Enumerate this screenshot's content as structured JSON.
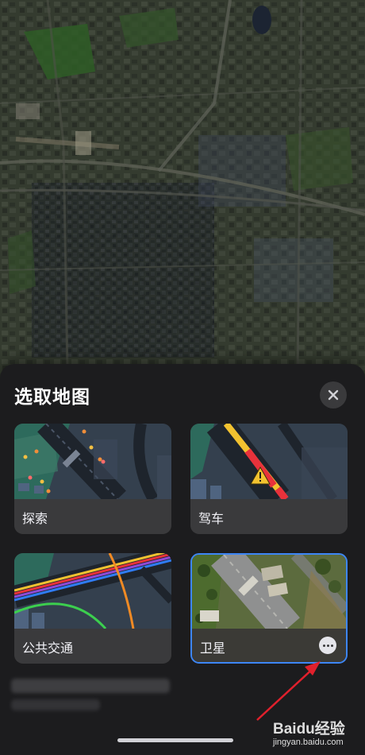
{
  "sheet": {
    "title": "选取地图",
    "close_icon": "close-icon"
  },
  "map_options": [
    {
      "id": "explore",
      "label": "探索",
      "selected": false
    },
    {
      "id": "driving",
      "label": "驾车",
      "selected": false
    },
    {
      "id": "transit",
      "label": "公共交通",
      "selected": false
    },
    {
      "id": "satellite",
      "label": "卫星",
      "selected": true,
      "more_icon": "ellipsis-icon"
    }
  ],
  "colors": {
    "sheet_background": "#1c1c1e",
    "card_label_background": "#3a3a3c",
    "selected_border": "#3d86f5",
    "annotation_arrow": "#e0202c"
  },
  "watermark": {
    "brand": "Baidu经验",
    "url": "jingyan.baidu.com"
  }
}
